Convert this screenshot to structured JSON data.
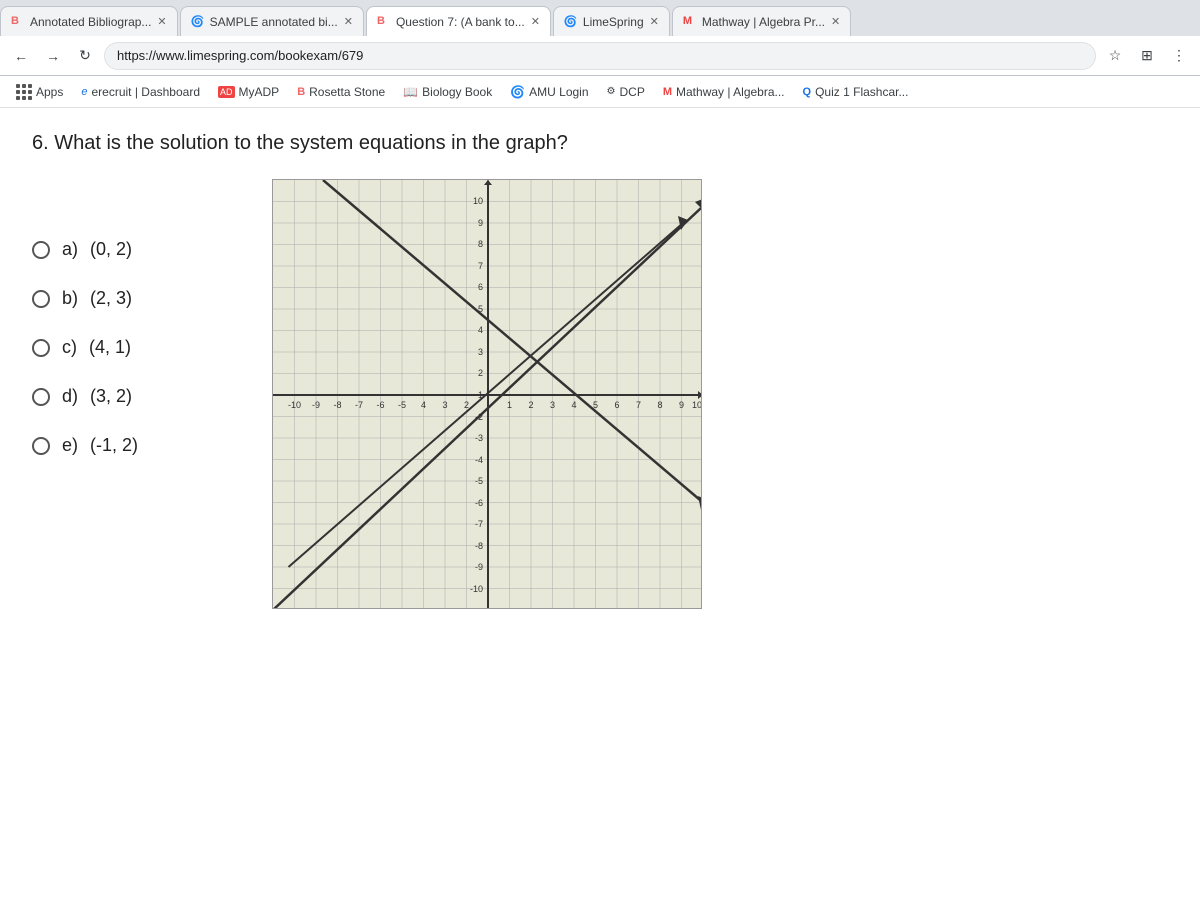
{
  "browser": {
    "tabs": [
      {
        "id": "tab1",
        "label": "Annotated Bibliograp...",
        "favicon": "B",
        "active": false
      },
      {
        "id": "tab2",
        "label": "SAMPLE annotated bi...",
        "favicon": "🌀",
        "active": false
      },
      {
        "id": "tab3",
        "label": "Question 7: (A bank to...",
        "favicon": "B",
        "active": true
      },
      {
        "id": "tab4",
        "label": "LimeSpring",
        "favicon": "🌀",
        "active": false
      },
      {
        "id": "tab5",
        "label": "Mathway | Algebra Pr...",
        "favicon": "M",
        "active": false
      }
    ],
    "address": "https://www.limespring.com/bookexam/679"
  },
  "bookmarks": {
    "apps_label": "Apps",
    "items": [
      {
        "label": "erecruit | Dashboard",
        "icon": "e"
      },
      {
        "label": "MyADP",
        "icon": "AD"
      },
      {
        "label": "Rosetta Stone",
        "icon": "B"
      },
      {
        "label": "Biology Book",
        "icon": "📖"
      },
      {
        "label": "AMU Login",
        "icon": "🌀"
      },
      {
        "label": "DCP",
        "icon": "D"
      },
      {
        "label": "Mathway | Algebra...",
        "icon": "M"
      },
      {
        "label": "Quiz 1 Flashcar...",
        "icon": "Q"
      }
    ]
  },
  "question": {
    "number": "6.",
    "text": "What is the solution to the system equations in the graph?",
    "choices": [
      {
        "id": "a",
        "label": "a)",
        "value": "(0, 2)"
      },
      {
        "id": "b",
        "label": "b)",
        "value": "(2, 3)"
      },
      {
        "id": "c",
        "label": "c)",
        "value": "(4, 1)"
      },
      {
        "id": "d",
        "label": "d)",
        "value": "(3, 2)"
      },
      {
        "id": "e",
        "label": "e)",
        "value": "(-1, 2)"
      }
    ]
  },
  "graph": {
    "min": -10,
    "max": 10,
    "grid_color": "#aaa",
    "bg_color": "#e8e8d8",
    "axis_color": "#333",
    "line1_color": "#333",
    "line2_color": "#333"
  }
}
